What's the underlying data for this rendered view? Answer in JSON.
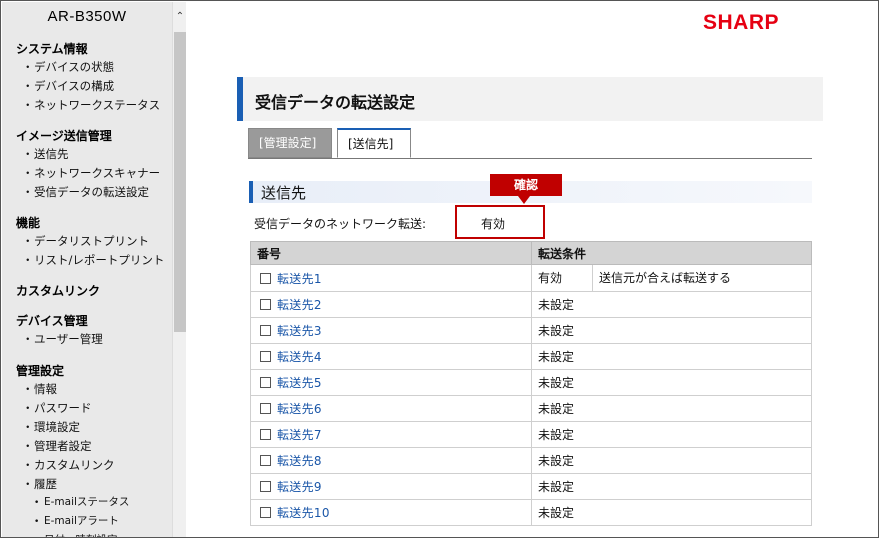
{
  "sidebar": {
    "model": "AR-B350W",
    "scroll_up_glyph": "⌃",
    "groups": [
      {
        "heading": "システム情報",
        "items": [
          "デバイスの状態",
          "デバイスの構成",
          "ネットワークステータス"
        ]
      },
      {
        "heading": "イメージ送信管理",
        "items": [
          "送信先",
          "ネットワークスキャナー",
          "受信データの転送設定"
        ]
      },
      {
        "heading": "機能",
        "items": [
          "データリストプリント",
          "リスト/レポートプリント"
        ]
      },
      {
        "heading": "カスタムリンク",
        "items": []
      },
      {
        "heading": "デバイス管理",
        "items": [
          "ユーザー管理"
        ]
      },
      {
        "heading": "管理設定",
        "items": [
          "情報",
          "パスワード",
          "環境設定",
          "管理者設定",
          "カスタムリンク",
          "履歴"
        ]
      }
    ],
    "sub_items": [
      "E-mailステータス",
      "E-mailアラート",
      "日付・時刻設定"
    ],
    "bullet": "・",
    "sub_bullet": "•"
  },
  "header": {
    "logo": "SHARP",
    "page_title": "受信データの転送設定"
  },
  "tabs": [
    {
      "label": "[管理設定]",
      "active": false
    },
    {
      "label": "[送信先]",
      "active": true
    }
  ],
  "section": {
    "title": "送信先",
    "confirm_label": "確認",
    "forward_label": "受信データのネットワーク転送:",
    "forward_value": "有効"
  },
  "table": {
    "headers": [
      "番号",
      "転送条件"
    ],
    "rows": [
      {
        "name": "転送先1",
        "status": "有効",
        "condition": "送信元が合えば転送する"
      },
      {
        "name": "転送先2",
        "status": "未設定",
        "condition": ""
      },
      {
        "name": "転送先3",
        "status": "未設定",
        "condition": ""
      },
      {
        "name": "転送先4",
        "status": "未設定",
        "condition": ""
      },
      {
        "name": "転送先5",
        "status": "未設定",
        "condition": ""
      },
      {
        "name": "転送先6",
        "status": "未設定",
        "condition": ""
      },
      {
        "name": "転送先7",
        "status": "未設定",
        "condition": ""
      },
      {
        "name": "転送先8",
        "status": "未設定",
        "condition": ""
      },
      {
        "name": "転送先9",
        "status": "未設定",
        "condition": ""
      },
      {
        "name": "転送先10",
        "status": "未設定",
        "condition": ""
      }
    ]
  },
  "colors": {
    "brand_red": "#e60012",
    "accent_blue": "#1a5fb4",
    "highlight_red": "#c00000",
    "link_blue": "#1a56a8"
  }
}
